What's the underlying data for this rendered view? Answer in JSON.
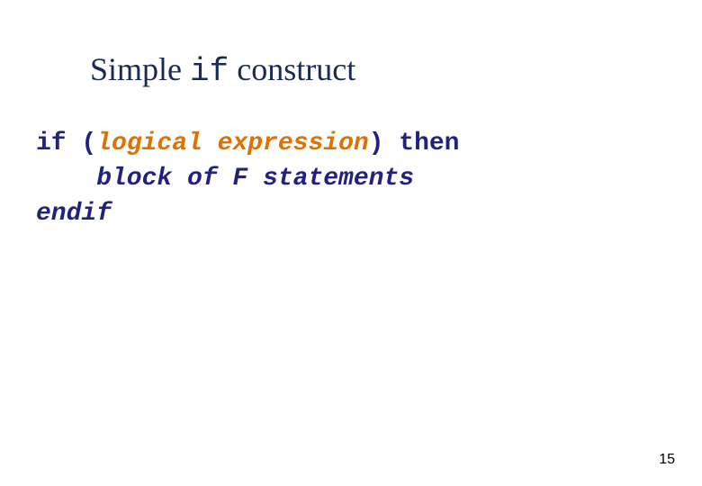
{
  "title": {
    "pre": "Simple ",
    "mono": "if",
    "post": " construct"
  },
  "code": {
    "line1": {
      "kw1": "if (",
      "expr": "logical expression",
      "kw2": ") then"
    },
    "line2": {
      "stmt": "block of F statements"
    },
    "line3": {
      "kw": "endif"
    }
  },
  "page_number": "15"
}
